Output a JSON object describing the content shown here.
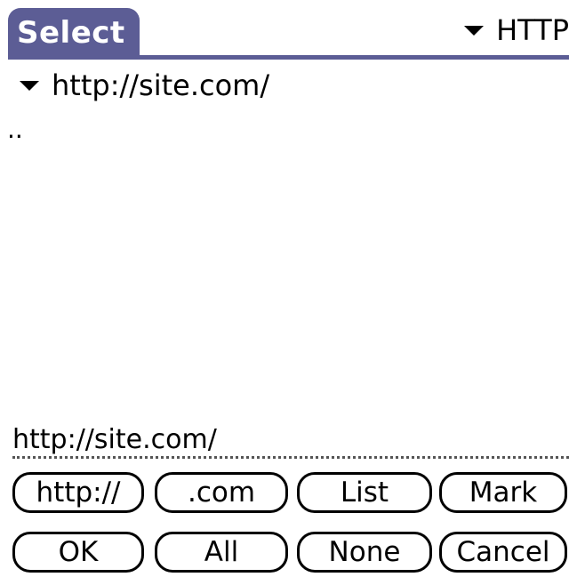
{
  "window": {
    "title": "Select"
  },
  "protocol_selector": {
    "selected": "HTTP"
  },
  "path_selector": {
    "selected": "http://site.com/"
  },
  "file_list": {
    "items": [
      ".."
    ]
  },
  "url_field": {
    "value": "http://site.com/"
  },
  "buttons": {
    "row1": [
      "http://",
      ".com",
      "List",
      "Mark"
    ],
    "row2": [
      "OK",
      "All",
      "None",
      "Cancel"
    ]
  },
  "colors": {
    "title_bar": "#5c5d95",
    "text": "#000000",
    "background": "#ffffff"
  }
}
